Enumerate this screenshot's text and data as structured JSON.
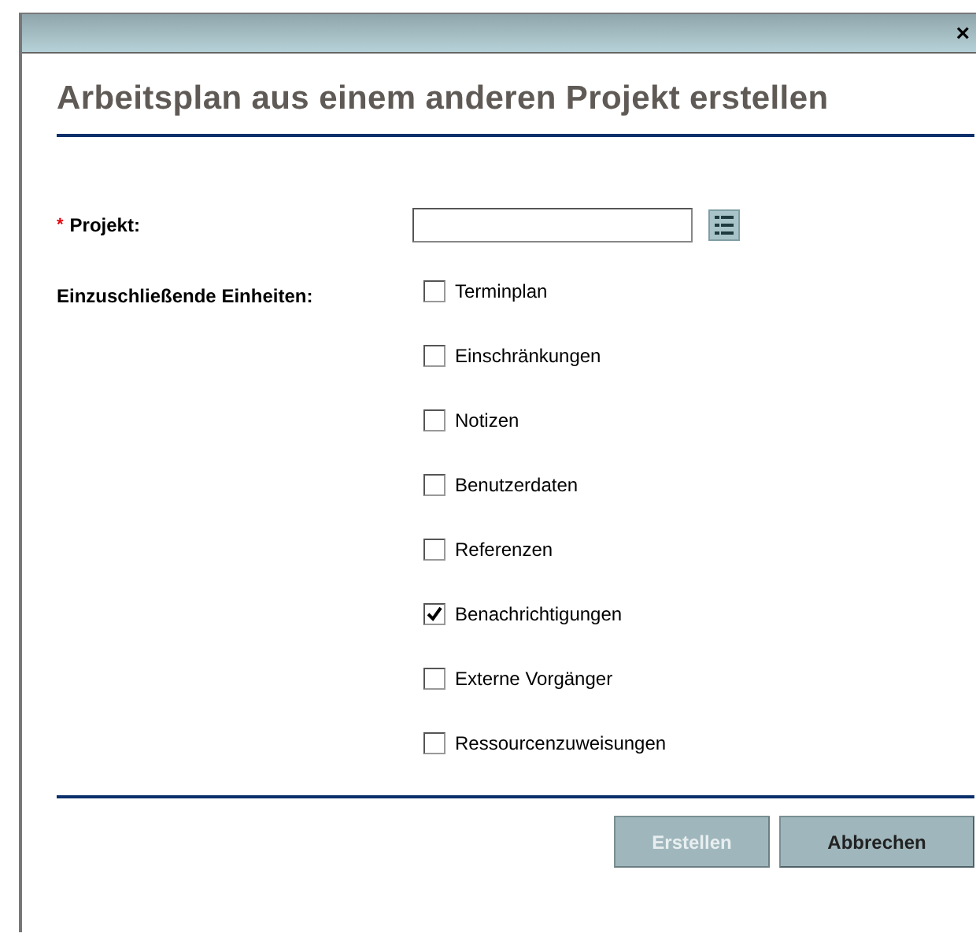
{
  "dialog": {
    "close": "×",
    "title": "Arbeitsplan aus einem anderen Projekt erstellen"
  },
  "project": {
    "label": "Projekt:",
    "required": true,
    "required_mark": "*"
  },
  "units": {
    "label": "Einzuschließende Einheiten:",
    "options": [
      {
        "label": "Terminplan",
        "checked": false
      },
      {
        "label": "Einschränkungen",
        "checked": false
      },
      {
        "label": "Notizen",
        "checked": false
      },
      {
        "label": "Benutzerdaten",
        "checked": false
      },
      {
        "label": "Referenzen",
        "checked": false
      },
      {
        "label": "Benachrichtigungen",
        "checked": true
      },
      {
        "label": "Externe Vorgänger",
        "checked": false
      },
      {
        "label": "Ressourcenzuweisungen",
        "checked": false
      }
    ]
  },
  "buttons": [
    {
      "label": "Erstellen",
      "disabled": true
    },
    {
      "label": "Abbrechen",
      "disabled": false
    }
  ]
}
